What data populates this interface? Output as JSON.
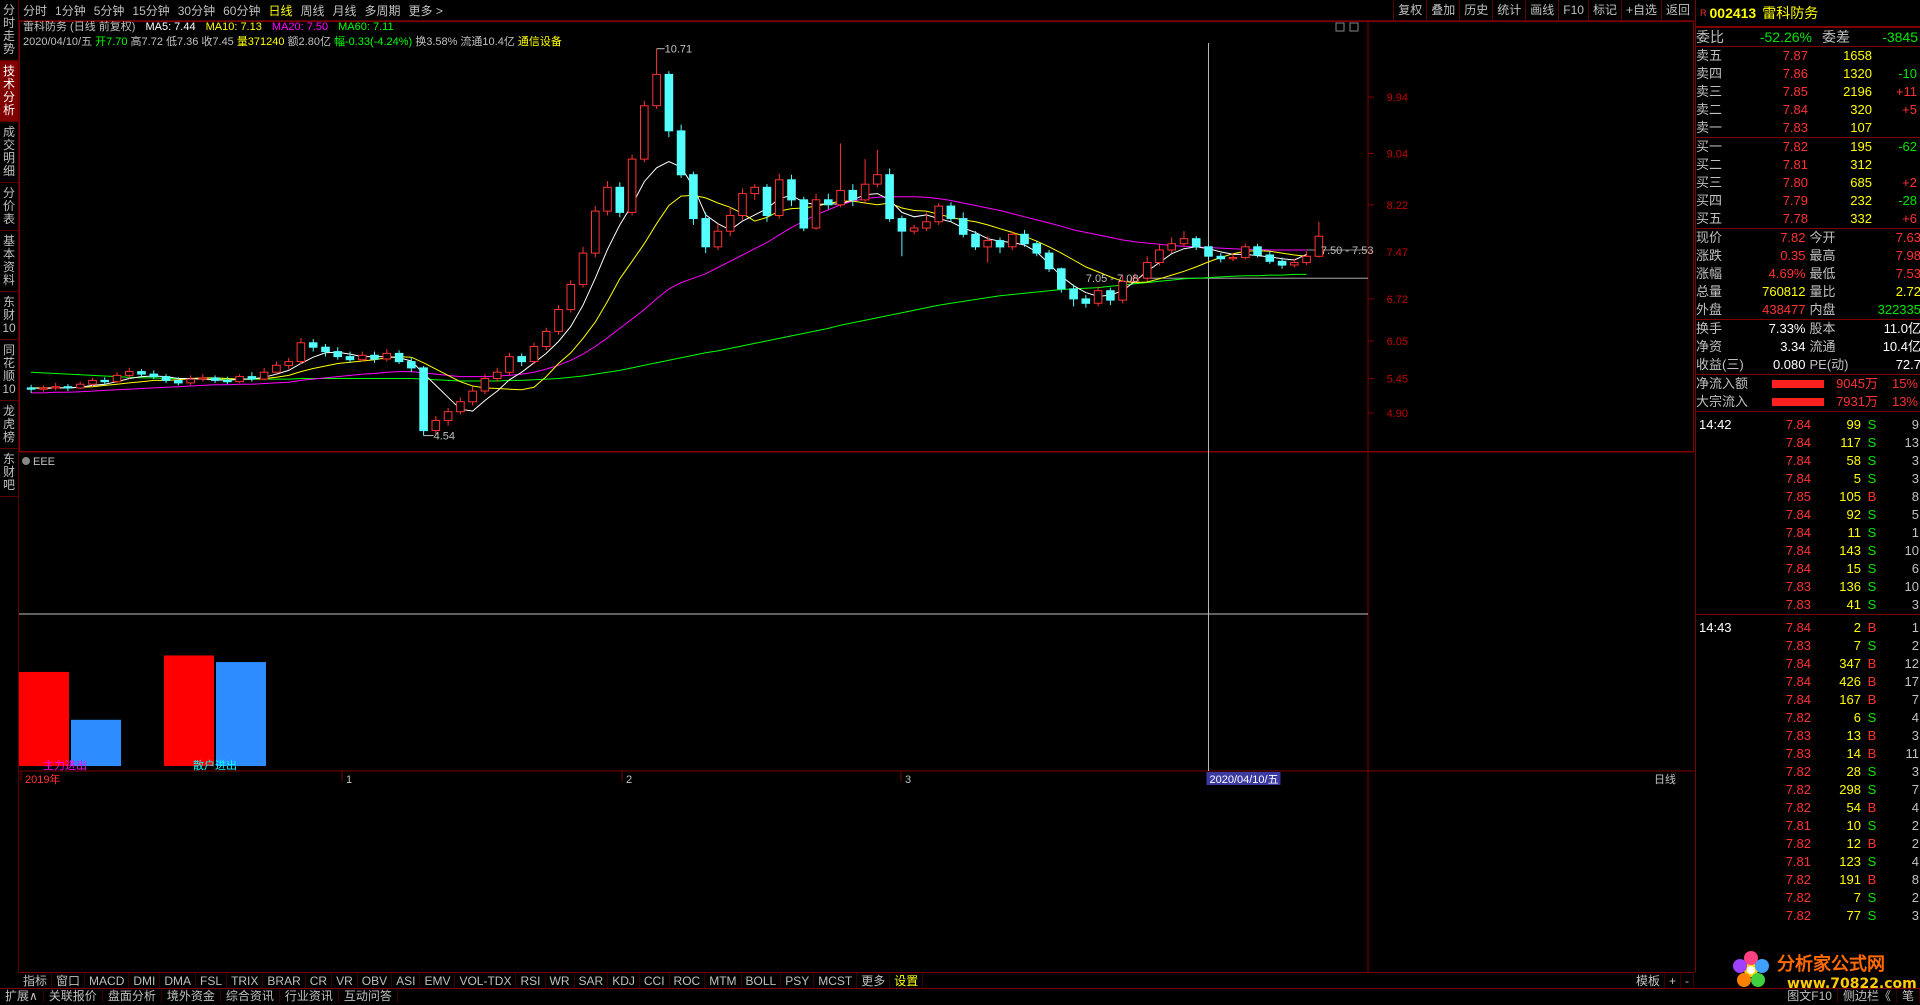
{
  "left_tabs": [
    "分时走势",
    "技术分析",
    "成交明细",
    "分价表",
    "基本资料",
    "东财10",
    "同花顺10",
    "龙虎榜",
    "东财吧"
  ],
  "left_active": 1,
  "periods": [
    "分时",
    "1分钟",
    "5分钟",
    "15分钟",
    "30分钟",
    "60分钟",
    "日线",
    "周线",
    "月线",
    "多周期",
    "更多 >"
  ],
  "period_active": 6,
  "tools": [
    "复权",
    "叠加",
    "历史",
    "统计",
    "画线",
    "F10",
    "标记",
    "+自选",
    "返回"
  ],
  "header": {
    "name": "雷科防务 (日线 前复权)",
    "ma5": "MA5: 7.44",
    "ma10": "MA10: 7.13",
    "ma20": "MA20: 7.50",
    "ma60": "MA60: 7.11",
    "date": "2020/04/10/五",
    "open": "开7.70",
    "high": "高7.72",
    "low": "低7.36",
    "close": "收7.45",
    "vol": "量371240",
    "amt": "额2.80亿",
    "chg": "幅-0.33(-4.24%)",
    "turn": "换3.58%",
    "float": "流通10.4亿",
    "industry": "通信设备"
  },
  "colors": {
    "up": "#ff3232",
    "down": "#54ffff",
    "ma5": "#ffffff",
    "ma10": "#ffff00",
    "ma20": "#ff00ff",
    "ma60": "#00ff00",
    "grid": "#800000"
  },
  "price_labels": [
    "9.94",
    "9.04",
    "8.22",
    "7.47",
    "6.72",
    "6.05",
    "5.45",
    "4.90"
  ],
  "annotations": {
    "high": "10.71",
    "low": "4.54",
    "range1": "7.05 - 7.08",
    "range2": "7.50 - 7.53"
  },
  "sub": {
    "title": "EEE",
    "main_label": "主力进出",
    "retail_label": "散户进出",
    "bars": [
      0.57,
      0.28,
      0.67,
      0.63
    ]
  },
  "xaxis": {
    "labels": [
      "2019年",
      "1",
      "2",
      "3",
      "4"
    ],
    "cursor_date": "2020/04/10/五",
    "period": "日线"
  },
  "chart_data": {
    "type": "candlestick",
    "candles": [
      [
        5.3,
        5.28,
        5.35,
        5.22
      ],
      [
        5.28,
        5.3,
        5.34,
        5.24
      ],
      [
        5.3,
        5.32,
        5.38,
        5.26
      ],
      [
        5.32,
        5.3,
        5.36,
        5.25
      ],
      [
        5.3,
        5.36,
        5.4,
        5.28
      ],
      [
        5.36,
        5.42,
        5.46,
        5.32
      ],
      [
        5.42,
        5.4,
        5.47,
        5.36
      ],
      [
        5.4,
        5.5,
        5.55,
        5.38
      ],
      [
        5.5,
        5.56,
        5.62,
        5.45
      ],
      [
        5.56,
        5.52,
        5.6,
        5.48
      ],
      [
        5.52,
        5.48,
        5.58,
        5.44
      ],
      [
        5.48,
        5.42,
        5.52,
        5.38
      ],
      [
        5.42,
        5.38,
        5.47,
        5.34
      ],
      [
        5.38,
        5.44,
        5.5,
        5.35
      ],
      [
        5.44,
        5.46,
        5.52,
        5.4
      ],
      [
        5.46,
        5.42,
        5.5,
        5.38
      ],
      [
        5.42,
        5.4,
        5.48,
        5.36
      ],
      [
        5.4,
        5.48,
        5.52,
        5.38
      ],
      [
        5.48,
        5.44,
        5.55,
        5.4
      ],
      [
        5.44,
        5.55,
        5.62,
        5.42
      ],
      [
        5.55,
        5.66,
        5.72,
        5.52
      ],
      [
        5.66,
        5.72,
        5.78,
        5.6
      ],
      [
        5.72,
        6.02,
        6.1,
        5.68
      ],
      [
        6.02,
        5.95,
        6.08,
        5.88
      ],
      [
        5.95,
        5.88,
        6.0,
        5.8
      ],
      [
        5.88,
        5.8,
        5.95,
        5.75
      ],
      [
        5.8,
        5.75,
        5.88,
        5.7
      ],
      [
        5.75,
        5.82,
        5.88,
        5.72
      ],
      [
        5.82,
        5.76,
        5.88,
        5.7
      ],
      [
        5.76,
        5.85,
        5.92,
        5.72
      ],
      [
        5.85,
        5.72,
        5.9,
        5.68
      ],
      [
        5.72,
        5.62,
        5.78,
        5.55
      ],
      [
        5.62,
        4.62,
        5.65,
        4.54
      ],
      [
        4.62,
        4.78,
        4.85,
        4.55
      ],
      [
        4.78,
        4.92,
        4.98,
        4.7
      ],
      [
        4.92,
        5.08,
        5.15,
        4.88
      ],
      [
        5.08,
        5.25,
        5.32,
        5.02
      ],
      [
        5.25,
        5.45,
        5.52,
        5.2
      ],
      [
        5.45,
        5.55,
        5.62,
        5.4
      ],
      [
        5.55,
        5.8,
        5.86,
        5.5
      ],
      [
        5.8,
        5.72,
        5.85,
        5.65
      ],
      [
        5.72,
        5.96,
        6.02,
        5.68
      ],
      [
        5.96,
        6.2,
        6.26,
        5.9
      ],
      [
        6.2,
        6.55,
        6.62,
        6.15
      ],
      [
        6.55,
        6.95,
        7.02,
        6.5
      ],
      [
        6.95,
        7.45,
        7.55,
        6.9
      ],
      [
        7.45,
        8.12,
        8.2,
        7.38
      ],
      [
        8.12,
        8.5,
        8.6,
        8.05
      ],
      [
        8.5,
        8.1,
        8.58,
        8.02
      ],
      [
        8.1,
        8.95,
        9.02,
        8.05
      ],
      [
        8.95,
        9.8,
        9.88,
        8.9
      ],
      [
        9.8,
        10.3,
        10.71,
        9.75
      ],
      [
        10.3,
        9.4,
        10.35,
        9.3
      ],
      [
        9.4,
        8.7,
        9.5,
        8.65
      ],
      [
        8.7,
        8.0,
        8.75,
        7.9
      ],
      [
        8.0,
        7.55,
        8.1,
        7.45
      ],
      [
        7.55,
        7.8,
        7.92,
        7.5
      ],
      [
        7.8,
        8.05,
        8.18,
        7.72
      ],
      [
        8.05,
        8.4,
        8.48,
        7.98
      ],
      [
        8.4,
        8.5,
        8.55,
        8.3
      ],
      [
        8.5,
        8.05,
        8.55,
        7.95
      ],
      [
        8.05,
        8.62,
        8.72,
        8.0
      ],
      [
        8.62,
        8.3,
        8.7,
        8.2
      ],
      [
        8.3,
        7.85,
        8.35,
        7.8
      ],
      [
        7.85,
        8.3,
        8.4,
        7.82
      ],
      [
        8.3,
        8.22,
        8.4,
        8.15
      ],
      [
        8.22,
        8.45,
        9.2,
        8.18
      ],
      [
        8.45,
        8.3,
        8.55,
        8.2
      ],
      [
        8.3,
        8.55,
        8.95,
        8.25
      ],
      [
        8.55,
        8.7,
        9.1,
        8.5
      ],
      [
        8.7,
        8.0,
        8.8,
        7.95
      ],
      [
        8.0,
        7.8,
        8.05,
        7.4
      ],
      [
        7.8,
        7.85,
        7.9,
        7.75
      ],
      [
        7.85,
        7.95,
        8.1,
        7.8
      ],
      [
        7.95,
        8.2,
        8.25,
        7.9
      ],
      [
        8.2,
        8.0,
        8.26,
        7.95
      ],
      [
        8.0,
        7.75,
        8.1,
        7.7
      ],
      [
        7.75,
        7.55,
        7.8,
        7.5
      ],
      [
        7.55,
        7.65,
        7.72,
        7.3
      ],
      [
        7.65,
        7.55,
        7.7,
        7.45
      ],
      [
        7.55,
        7.75,
        7.8,
        7.5
      ],
      [
        7.75,
        7.6,
        7.82,
        7.55
      ],
      [
        7.6,
        7.45,
        7.65,
        7.4
      ],
      [
        7.45,
        7.2,
        7.5,
        7.15
      ],
      [
        7.2,
        6.88,
        7.22,
        6.82
      ],
      [
        6.88,
        6.72,
        6.95,
        6.6
      ],
      [
        6.72,
        6.65,
        6.78,
        6.58
      ],
      [
        6.65,
        6.85,
        6.92,
        6.6
      ],
      [
        6.85,
        6.7,
        6.9,
        6.62
      ],
      [
        6.7,
        7.0,
        7.1,
        6.65
      ],
      [
        7.0,
        7.05,
        7.12,
        6.98
      ],
      [
        7.05,
        7.3,
        7.4,
        7.0
      ],
      [
        7.3,
        7.5,
        7.6,
        7.25
      ],
      [
        7.5,
        7.6,
        7.7,
        7.45
      ],
      [
        7.6,
        7.68,
        7.8,
        7.55
      ],
      [
        7.68,
        7.55,
        7.72,
        7.5
      ],
      [
        7.55,
        7.4,
        7.58,
        7.35
      ],
      [
        7.4,
        7.36,
        7.45,
        7.3
      ],
      [
        7.36,
        7.38,
        7.45,
        7.32
      ],
      [
        7.38,
        7.55,
        7.6,
        7.35
      ],
      [
        7.55,
        7.42,
        7.6,
        7.38
      ],
      [
        7.42,
        7.32,
        7.48,
        7.28
      ],
      [
        7.32,
        7.26,
        7.38,
        7.2
      ],
      [
        7.26,
        7.3,
        7.36,
        7.22
      ],
      [
        7.3,
        7.4,
        7.48,
        7.26
      ],
      [
        7.4,
        7.72,
        7.95,
        7.38
      ]
    ],
    "ma5": [
      5.3,
      5.29,
      5.3,
      5.3,
      5.31,
      5.34,
      5.36,
      5.4,
      5.45,
      5.48,
      5.49,
      5.48,
      5.45,
      5.45,
      5.44,
      5.43,
      5.42,
      5.44,
      5.44,
      5.47,
      5.52,
      5.58,
      5.69,
      5.79,
      5.86,
      5.87,
      5.84,
      5.8,
      5.8,
      5.8,
      5.78,
      5.73,
      5.53,
      5.34,
      5.15,
      4.96,
      4.93,
      5.1,
      5.25,
      5.43,
      5.55,
      5.7,
      5.85,
      6.04,
      6.28,
      6.62,
      7.05,
      7.51,
      7.9,
      8.22,
      8.59,
      8.81,
      8.91,
      8.82,
      8.51,
      8.06,
      7.92,
      7.82,
      7.96,
      8.06,
      8.16,
      8.32,
      8.37,
      8.26,
      8.22,
      8.24,
      8.23,
      8.3,
      8.38,
      8.4,
      8.3,
      8.1,
      8.03,
      8.06,
      8.0,
      7.95,
      7.85,
      7.78,
      7.68,
      7.64,
      7.62,
      7.58,
      7.47,
      7.28,
      7.08,
      6.93,
      6.82,
      6.76,
      6.78,
      6.85,
      7.0,
      7.16,
      7.3,
      7.44,
      7.52,
      7.55,
      7.52,
      7.47,
      7.43,
      7.43,
      7.41,
      7.39,
      7.36,
      7.34,
      7.43
    ],
    "ma10": [
      5.3,
      5.3,
      5.3,
      5.3,
      5.31,
      5.32,
      5.34,
      5.36,
      5.38,
      5.4,
      5.42,
      5.42,
      5.43,
      5.45,
      5.46,
      5.46,
      5.45,
      5.44,
      5.44,
      5.45,
      5.47,
      5.5,
      5.56,
      5.61,
      5.65,
      5.69,
      5.71,
      5.73,
      5.75,
      5.78,
      5.8,
      5.79,
      5.7,
      5.6,
      5.5,
      5.4,
      5.33,
      5.3,
      5.29,
      5.28,
      5.27,
      5.31,
      5.48,
      5.69,
      5.86,
      6.09,
      6.35,
      6.68,
      7.04,
      7.32,
      7.6,
      7.92,
      8.21,
      8.36,
      8.37,
      8.33,
      8.25,
      8.18,
      8.08,
      7.96,
      8.02,
      8.12,
      8.16,
      8.17,
      8.2,
      8.24,
      8.28,
      8.28,
      8.25,
      8.22,
      8.25,
      8.17,
      8.13,
      8.12,
      8.07,
      8.02,
      7.98,
      7.95,
      7.9,
      7.84,
      7.78,
      7.72,
      7.64,
      7.55,
      7.45,
      7.34,
      7.23,
      7.15,
      7.07,
      7.0,
      6.98,
      6.99,
      7.04,
      7.1,
      7.16,
      7.23,
      7.31,
      7.38,
      7.44,
      7.48,
      7.49,
      7.48,
      7.45,
      7.42,
      7.4
    ],
    "ma20": [
      5.22,
      5.22,
      5.23,
      5.23,
      5.24,
      5.25,
      5.26,
      5.27,
      5.28,
      5.29,
      5.3,
      5.31,
      5.32,
      5.33,
      5.34,
      5.35,
      5.35,
      5.36,
      5.36,
      5.37,
      5.38,
      5.39,
      5.42,
      5.44,
      5.46,
      5.48,
      5.5,
      5.52,
      5.53,
      5.55,
      5.56,
      5.56,
      5.54,
      5.52,
      5.5,
      5.48,
      5.48,
      5.48,
      5.49,
      5.5,
      5.52,
      5.55,
      5.6,
      5.66,
      5.74,
      5.84,
      5.96,
      6.1,
      6.25,
      6.4,
      6.55,
      6.72,
      6.88,
      6.98,
      7.05,
      7.12,
      7.22,
      7.32,
      7.42,
      7.52,
      7.62,
      7.74,
      7.86,
      7.96,
      8.06,
      8.14,
      8.22,
      8.28,
      8.32,
      8.34,
      8.35,
      8.35,
      8.35,
      8.34,
      8.32,
      8.29,
      8.25,
      8.21,
      8.17,
      8.13,
      8.08,
      8.03,
      7.98,
      7.93,
      7.88,
      7.82,
      7.78,
      7.74,
      7.7,
      7.66,
      7.63,
      7.61,
      7.59,
      7.57,
      7.56,
      7.55,
      7.54,
      7.53,
      7.52,
      7.51,
      7.51,
      7.5,
      7.5,
      7.5,
      7.5
    ],
    "ma60": [
      5.55,
      5.54,
      5.53,
      5.52,
      5.51,
      5.5,
      5.49,
      5.48,
      5.47,
      5.46,
      5.46,
      5.45,
      5.45,
      5.45,
      5.44,
      5.44,
      5.44,
      5.44,
      5.44,
      5.44,
      5.44,
      5.44,
      5.45,
      5.45,
      5.45,
      5.45,
      5.45,
      5.45,
      5.45,
      5.45,
      5.45,
      5.45,
      5.44,
      5.43,
      5.42,
      5.41,
      5.41,
      5.41,
      5.41,
      5.42,
      5.42,
      5.43,
      5.44,
      5.45,
      5.47,
      5.49,
      5.52,
      5.55,
      5.58,
      5.62,
      5.66,
      5.7,
      5.74,
      5.78,
      5.82,
      5.86,
      5.89,
      5.93,
      5.97,
      6.01,
      6.05,
      6.09,
      6.13,
      6.17,
      6.21,
      6.25,
      6.3,
      6.34,
      6.38,
      6.42,
      6.46,
      6.5,
      6.54,
      6.58,
      6.62,
      6.65,
      6.68,
      6.71,
      6.74,
      6.77,
      6.79,
      6.81,
      6.83,
      6.85,
      6.87,
      6.88,
      6.89,
      6.9,
      6.92,
      6.94,
      6.96,
      6.98,
      7.0,
      7.02,
      7.04,
      7.05,
      7.06,
      7.07,
      7.08,
      7.09,
      7.09,
      7.1,
      7.1,
      7.11,
      7.11
    ]
  },
  "quote": {
    "code": "002413",
    "name": "雷科防务",
    "wb_label": "委比",
    "wb": "-52.26%",
    "wc_label": "委差",
    "wc": "-3845",
    "asks": [
      [
        "卖五",
        "7.87",
        "1658",
        ""
      ],
      [
        "卖四",
        "7.86",
        "1320",
        "-10"
      ],
      [
        "卖三",
        "7.85",
        "2196",
        "+11"
      ],
      [
        "卖二",
        "7.84",
        "320",
        "+5"
      ],
      [
        "卖一",
        "7.83",
        "107",
        ""
      ]
    ],
    "bids": [
      [
        "买一",
        "7.82",
        "195",
        "-62"
      ],
      [
        "买二",
        "7.81",
        "312",
        ""
      ],
      [
        "买三",
        "7.80",
        "685",
        "+2"
      ],
      [
        "买四",
        "7.79",
        "232",
        "-28"
      ],
      [
        "买五",
        "7.78",
        "332",
        "+6"
      ]
    ],
    "stats": [
      [
        "现价",
        "7.82",
        "今开",
        "7.63"
      ],
      [
        "涨跌",
        "0.35",
        "最高",
        "7.98"
      ],
      [
        "涨幅",
        "4.69%",
        "最低",
        "7.53"
      ],
      [
        "总量",
        "760812",
        "量比",
        "2.72"
      ],
      [
        "外盘",
        "438477",
        "内盘",
        "322335"
      ]
    ],
    "stats2": [
      [
        "换手",
        "7.33%",
        "股本",
        "11.0亿"
      ],
      [
        "净资",
        "3.34",
        "流通",
        "10.4亿"
      ],
      [
        "收益(三)",
        "0.080",
        "PE(动)",
        "72.7"
      ]
    ],
    "flows": [
      [
        "净流入额",
        "9045万",
        "15%"
      ],
      [
        "大宗流入",
        "7931万",
        "13%"
      ]
    ],
    "ticks_a_time": "14:42",
    "ticks_b_time": "14:43",
    "ticks_a": [
      [
        "7.84",
        "99",
        "S",
        "9"
      ],
      [
        "7.84",
        "117",
        "S",
        "13"
      ],
      [
        "7.84",
        "58",
        "S",
        "3"
      ],
      [
        "7.84",
        "5",
        "S",
        "3"
      ],
      [
        "7.85",
        "105",
        "B",
        "8"
      ],
      [
        "7.84",
        "92",
        "S",
        "5"
      ],
      [
        "7.84",
        "11",
        "S",
        "1"
      ],
      [
        "7.84",
        "143",
        "S",
        "10"
      ],
      [
        "7.84",
        "15",
        "S",
        "6"
      ],
      [
        "7.83",
        "136",
        "S",
        "10"
      ],
      [
        "7.83",
        "41",
        "S",
        "3"
      ]
    ],
    "ticks_b": [
      [
        "7.84",
        "2",
        "B",
        "1"
      ],
      [
        "7.83",
        "7",
        "S",
        "2"
      ],
      [
        "7.84",
        "347",
        "B",
        "12"
      ],
      [
        "7.84",
        "426",
        "B",
        "17"
      ],
      [
        "7.84",
        "167",
        "B",
        "7"
      ],
      [
        "7.82",
        "6",
        "S",
        "4"
      ],
      [
        "7.83",
        "13",
        "B",
        "3"
      ],
      [
        "7.83",
        "14",
        "B",
        "11"
      ],
      [
        "7.82",
        "28",
        "S",
        "3"
      ],
      [
        "7.82",
        "298",
        "S",
        "7"
      ],
      [
        "7.82",
        "54",
        "B",
        "4"
      ],
      [
        "7.81",
        "10",
        "S",
        "2"
      ],
      [
        "7.82",
        "12",
        "B",
        "2"
      ],
      [
        "7.81",
        "123",
        "S",
        "4"
      ],
      [
        "7.82",
        "191",
        "B",
        "8"
      ],
      [
        "7.82",
        "7",
        "S",
        "2"
      ],
      [
        "7.82",
        "77",
        "S",
        "3"
      ]
    ]
  },
  "indicators": [
    "指标",
    "窗口",
    "MACD",
    "DMI",
    "DMA",
    "FSL",
    "TRIX",
    "BRAR",
    "CR",
    "VR",
    "OBV",
    "ASI",
    "EMV",
    "VOL-TDX",
    "RSI",
    "WR",
    "SAR",
    "KDJ",
    "CCI",
    "ROC",
    "MTM",
    "BOLL",
    "PSY",
    "MCST",
    "更多",
    "设置"
  ],
  "ind_right": [
    "模板",
    "+",
    "-"
  ],
  "status": [
    "扩展∧",
    "关联报价",
    "盘面分析",
    "境外资金",
    "综合资讯",
    "行业资讯",
    "互动问答"
  ],
  "status_right": [
    "图文F10",
    "侧边栏《",
    "笔"
  ],
  "logo_text": "分析家公式网",
  "logo_url": "www.70822.com"
}
